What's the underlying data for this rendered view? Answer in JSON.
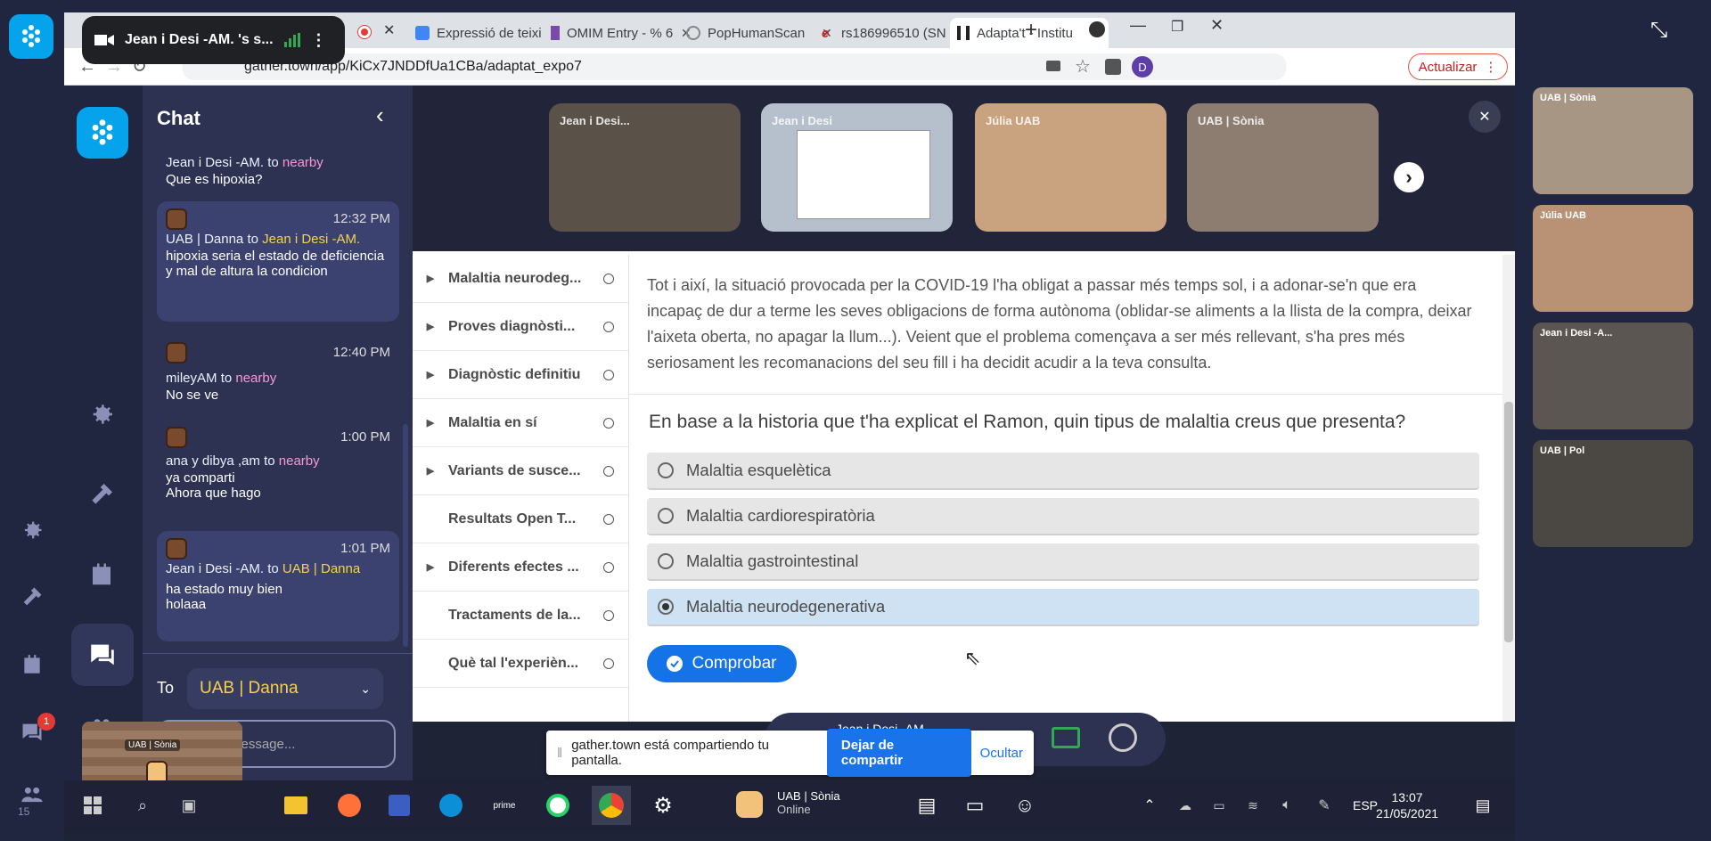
{
  "meet": {
    "title": "Jean i Desi -AM. 's s..."
  },
  "browser": {
    "tabs": [
      {
        "label": "Expressió de teixi"
      },
      {
        "label": "OMIM Entry - % 6"
      },
      {
        "label": "PopHumanScan"
      },
      {
        "label": "rs186996510 (SN"
      },
      {
        "label": "Adapta't - Institu"
      }
    ],
    "url": "gather.town/app/KiCx7JNDDfUa1CBa/adaptat_expo7",
    "update_label": "Actualizar",
    "profile_initial": "D"
  },
  "chat": {
    "title": "Chat",
    "messages": [
      {
        "time": "",
        "sender": "Jean i Desi -AM.",
        "to_word": "to",
        "target": "nearby",
        "text": "Que es hipoxia?"
      },
      {
        "time": "12:32 PM",
        "sender": "UAB | Danna",
        "to_word": "to",
        "target": "Jean i Desi -AM.",
        "text": "hipoxia seria el estado de deficiencia y mal de altura la condicion"
      },
      {
        "time": "12:40 PM",
        "sender": "mileyAM",
        "to_word": "to",
        "target": "nearby",
        "text": "No se ve"
      },
      {
        "time": "1:00 PM",
        "sender": "ana y dibya ,am",
        "to_word": "to",
        "target": "nearby",
        "text": "ya comparti\nAhora que hago"
      },
      {
        "time": "1:01 PM",
        "sender": "Jean i Desi -AM.",
        "to_word": "to",
        "target": "UAB | Danna",
        "text": "ha estado muy bien\nholaaa"
      }
    ],
    "to_label": "To",
    "to_value": "UAB | Danna",
    "input_placeholder": "Message...",
    "mini_avatar_label": "UAB | Sònia"
  },
  "videos": [
    {
      "name": "Jean i Desi...",
      "color": "#5a5148"
    },
    {
      "name": "Jean i Desi",
      "color": "#b6bfcc"
    },
    {
      "name": "Júlia UAB",
      "color": "#c9a27f"
    },
    {
      "name": "UAB | Sònia",
      "color": "#8d7d70"
    }
  ],
  "right_videos": [
    {
      "name": "UAB | Sònia",
      "color": "#a89684"
    },
    {
      "name": "Júlia UAB",
      "color": "#b99276"
    },
    {
      "name": "Jean i Desi -A...",
      "color": "#5c5652"
    },
    {
      "name": "UAB | Pol",
      "color": "#4b4743"
    }
  ],
  "nav": [
    {
      "label": "Malaltia neurodeg...",
      "arrow": true
    },
    {
      "label": "Proves diagnòsti...",
      "arrow": true
    },
    {
      "label": "Diagnòstic definitiu",
      "arrow": true
    },
    {
      "label": "Malaltia en sí",
      "arrow": true
    },
    {
      "label": "Variants de susce...",
      "arrow": true
    },
    {
      "label": "Resultats Open T...",
      "arrow": false
    },
    {
      "label": "Diferents efectes ...",
      "arrow": true
    },
    {
      "label": "Tractaments de la...",
      "arrow": false
    },
    {
      "label": "Què tal l'experièn...",
      "arrow": false
    }
  ],
  "content": {
    "paragraph": "Tot i així, la situació provocada per la COVID-19 l'ha obligat a passar més temps sol, i a adonar-se'n que era incapaç de dur a terme les seves obligacions de forma autònoma (oblidar-se aliments a la llista de la compra, deixar l'aixeta oberta, no apagar la llum...). Veient que el problema començava a ser més rellevant, s'ha pres més seriosament les recomanacions del seu fill i ha decidit acudir a la teva consulta.",
    "question": "En base a la historia que t'ha explicat el Ramon, quin tipus de malaltia creus que presenta?",
    "options": [
      {
        "label": "Malaltia esquelètica",
        "selected": false
      },
      {
        "label": "Malaltia cardiorespiratòria",
        "selected": false
      },
      {
        "label": "Malaltia gastrointestinal",
        "selected": false
      },
      {
        "label": "Malaltia neurodegenerativa",
        "selected": true
      }
    ],
    "check_button": "Comprobar"
  },
  "share_bar": {
    "text": "gather.town está compartiendo tu pantalla.",
    "stop": "Dejar de compartir",
    "hide": "Ocultar"
  },
  "gather_bar": {
    "name": "Jean i Desi -AM."
  },
  "taskbar": {
    "user_name": "UAB | Sònia",
    "user_status": "Online",
    "lang": "ESP",
    "time": "13:07",
    "date": "21/05/2021",
    "notif_count": "1",
    "people_count": "15"
  }
}
